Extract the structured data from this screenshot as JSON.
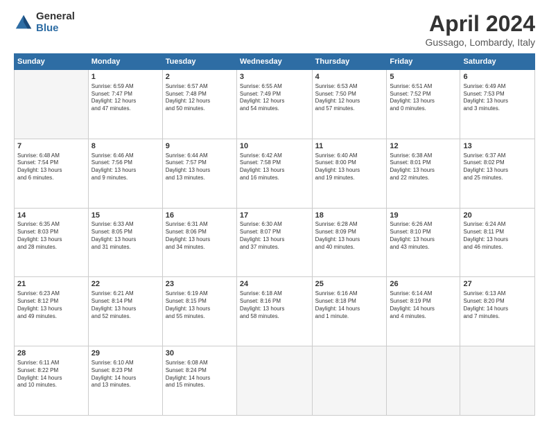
{
  "logo": {
    "general": "General",
    "blue": "Blue"
  },
  "title": "April 2024",
  "location": "Gussago, Lombardy, Italy",
  "headers": [
    "Sunday",
    "Monday",
    "Tuesday",
    "Wednesday",
    "Thursday",
    "Friday",
    "Saturday"
  ],
  "weeks": [
    [
      {
        "day": "",
        "info": ""
      },
      {
        "day": "1",
        "info": "Sunrise: 6:59 AM\nSunset: 7:47 PM\nDaylight: 12 hours\nand 47 minutes."
      },
      {
        "day": "2",
        "info": "Sunrise: 6:57 AM\nSunset: 7:48 PM\nDaylight: 12 hours\nand 50 minutes."
      },
      {
        "day": "3",
        "info": "Sunrise: 6:55 AM\nSunset: 7:49 PM\nDaylight: 12 hours\nand 54 minutes."
      },
      {
        "day": "4",
        "info": "Sunrise: 6:53 AM\nSunset: 7:50 PM\nDaylight: 12 hours\nand 57 minutes."
      },
      {
        "day": "5",
        "info": "Sunrise: 6:51 AM\nSunset: 7:52 PM\nDaylight: 13 hours\nand 0 minutes."
      },
      {
        "day": "6",
        "info": "Sunrise: 6:49 AM\nSunset: 7:53 PM\nDaylight: 13 hours\nand 3 minutes."
      }
    ],
    [
      {
        "day": "7",
        "info": "Sunrise: 6:48 AM\nSunset: 7:54 PM\nDaylight: 13 hours\nand 6 minutes."
      },
      {
        "day": "8",
        "info": "Sunrise: 6:46 AM\nSunset: 7:56 PM\nDaylight: 13 hours\nand 9 minutes."
      },
      {
        "day": "9",
        "info": "Sunrise: 6:44 AM\nSunset: 7:57 PM\nDaylight: 13 hours\nand 13 minutes."
      },
      {
        "day": "10",
        "info": "Sunrise: 6:42 AM\nSunset: 7:58 PM\nDaylight: 13 hours\nand 16 minutes."
      },
      {
        "day": "11",
        "info": "Sunrise: 6:40 AM\nSunset: 8:00 PM\nDaylight: 13 hours\nand 19 minutes."
      },
      {
        "day": "12",
        "info": "Sunrise: 6:38 AM\nSunset: 8:01 PM\nDaylight: 13 hours\nand 22 minutes."
      },
      {
        "day": "13",
        "info": "Sunrise: 6:37 AM\nSunset: 8:02 PM\nDaylight: 13 hours\nand 25 minutes."
      }
    ],
    [
      {
        "day": "14",
        "info": "Sunrise: 6:35 AM\nSunset: 8:03 PM\nDaylight: 13 hours\nand 28 minutes."
      },
      {
        "day": "15",
        "info": "Sunrise: 6:33 AM\nSunset: 8:05 PM\nDaylight: 13 hours\nand 31 minutes."
      },
      {
        "day": "16",
        "info": "Sunrise: 6:31 AM\nSunset: 8:06 PM\nDaylight: 13 hours\nand 34 minutes."
      },
      {
        "day": "17",
        "info": "Sunrise: 6:30 AM\nSunset: 8:07 PM\nDaylight: 13 hours\nand 37 minutes."
      },
      {
        "day": "18",
        "info": "Sunrise: 6:28 AM\nSunset: 8:09 PM\nDaylight: 13 hours\nand 40 minutes."
      },
      {
        "day": "19",
        "info": "Sunrise: 6:26 AM\nSunset: 8:10 PM\nDaylight: 13 hours\nand 43 minutes."
      },
      {
        "day": "20",
        "info": "Sunrise: 6:24 AM\nSunset: 8:11 PM\nDaylight: 13 hours\nand 46 minutes."
      }
    ],
    [
      {
        "day": "21",
        "info": "Sunrise: 6:23 AM\nSunset: 8:12 PM\nDaylight: 13 hours\nand 49 minutes."
      },
      {
        "day": "22",
        "info": "Sunrise: 6:21 AM\nSunset: 8:14 PM\nDaylight: 13 hours\nand 52 minutes."
      },
      {
        "day": "23",
        "info": "Sunrise: 6:19 AM\nSunset: 8:15 PM\nDaylight: 13 hours\nand 55 minutes."
      },
      {
        "day": "24",
        "info": "Sunrise: 6:18 AM\nSunset: 8:16 PM\nDaylight: 13 hours\nand 58 minutes."
      },
      {
        "day": "25",
        "info": "Sunrise: 6:16 AM\nSunset: 8:18 PM\nDaylight: 14 hours\nand 1 minute."
      },
      {
        "day": "26",
        "info": "Sunrise: 6:14 AM\nSunset: 8:19 PM\nDaylight: 14 hours\nand 4 minutes."
      },
      {
        "day": "27",
        "info": "Sunrise: 6:13 AM\nSunset: 8:20 PM\nDaylight: 14 hours\nand 7 minutes."
      }
    ],
    [
      {
        "day": "28",
        "info": "Sunrise: 6:11 AM\nSunset: 8:22 PM\nDaylight: 14 hours\nand 10 minutes."
      },
      {
        "day": "29",
        "info": "Sunrise: 6:10 AM\nSunset: 8:23 PM\nDaylight: 14 hours\nand 13 minutes."
      },
      {
        "day": "30",
        "info": "Sunrise: 6:08 AM\nSunset: 8:24 PM\nDaylight: 14 hours\nand 15 minutes."
      },
      {
        "day": "",
        "info": ""
      },
      {
        "day": "",
        "info": ""
      },
      {
        "day": "",
        "info": ""
      },
      {
        "day": "",
        "info": ""
      }
    ]
  ]
}
